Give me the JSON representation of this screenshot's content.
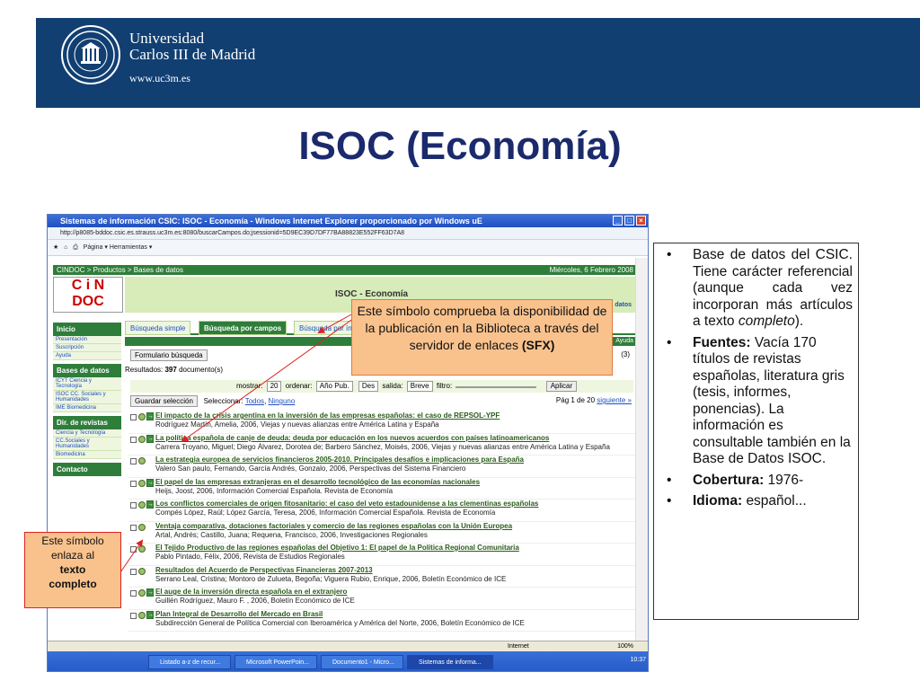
{
  "header": {
    "university_line1": "Universidad",
    "university_line2": "Carlos III de Madrid",
    "url": "www.uc3m.es"
  },
  "slide_title": "ISOC (Economía)",
  "browser": {
    "window_title": "Sistemas de información CSIC: ISOC - Economía - Windows Internet Explorer proporcionado por Windows uE",
    "address": "http://p8085-bddoc.csic.es.strauss.uc3m.es:8080/buscarCampos.do;jsessionid=5D9EC39D7DF77BA88823E552FF63D7A8",
    "toolbar": "Página ▾   Herramientas ▾",
    "cindoc_breadcrumb": "CINDOC  > Productos > Bases de datos",
    "date": "Miércoles, 6 Febrero 2008",
    "logo_text_1": "C i N",
    "logo_text_2": "DOC",
    "isoc_title": "ISOC - Economía",
    "datos_link": "datos",
    "sidebar": [
      {
        "head": "Inicio",
        "items": [
          "Presentación",
          "Suscripción",
          "Ayuda"
        ]
      },
      {
        "head": "Bases de datos",
        "items": [
          "ICYT Ciencia y Tecnología",
          "ISOC CC. Sociales y Humanidades",
          "IME Biomedicina"
        ]
      },
      {
        "head": "Dir. de revistas",
        "items": [
          "Ciencia y Tecnología",
          "CC.Sociales y Humanidades",
          "Biomedicina"
        ]
      },
      {
        "head": "Contacto",
        "items": []
      }
    ],
    "tabs": [
      "Búsqueda simple",
      "Búsqueda por campos",
      "Búsqueda por índ"
    ],
    "ayuda": "Ayuda",
    "form_button": "Formulario búsqueda",
    "count_right": "(3)",
    "results_label": "Resultados:",
    "results_count": "397",
    "results_suffix": "documento(s)",
    "controls": {
      "mostrar_label": "mostrar:",
      "mostrar_value": "20",
      "ordenar_label": "ordenar:",
      "ordenar_value": "Año Pub.",
      "dir_value": "Des",
      "salida_label": "salida:",
      "salida_value": "Breve",
      "filtro_label": "filtro:",
      "aplicar": "Aplicar"
    },
    "guardar": "Guardar selección",
    "seleccionar": "Seleccionar:",
    "todos": "Todos",
    "ninguno": "Ninguno",
    "page_info": "Pág 1 de 20",
    "siguiente": "siguiente »",
    "records": [
      {
        "title": "El impacto de la crisis argentina en la inversión de las empresas españolas: el caso de REPSOL-YPF",
        "authors": "Rodríguez Martín, Amelia,  2006,  Viejas y nuevas alianzas entre América Latina y España",
        "sfx": true
      },
      {
        "title": "La política española de canje de deuda: deuda por educación en los nuevos acuerdos con países latinoamericanos",
        "authors": "Carrera Troyano, Miguel; Diego Álvarez, Dorotea de; Barbero Sánchez, Moisés,  2006,  Viejas y nuevas alianzas entre América Latina y España",
        "sfx": true
      },
      {
        "title": "La estrategia europea de servicios financieros 2005-2010. Principales desafíos e implicaciones para España",
        "authors": "Valero San paulo, Fernando, García Andrés, Gonzalo,  2006,  Perspectivas del Sistema Financiero",
        "sfx": false
      },
      {
        "title": "El papel de las empresas extranjeras en el desarrollo tecnológico de las economías nacionales",
        "authors": "Heijs, Joost,  2006,  Información Comercial Española. Revista de Economía",
        "sfx": true
      },
      {
        "title": "Los conflictos comerciales de origen fitosanitario: el caso del veto estadounidense a las clementinas españolas",
        "authors": "Compés López, Raúl; López García, Teresa,  2006,  Información Comercial Española. Revista de Economía",
        "sfx": true
      },
      {
        "title": "Ventaja comparativa, dotaciones factoriales y comercio de las regiones españolas con la Unión Europea",
        "authors": "Artal, Andrés; Castillo, Juana; Requena, Francisco,  2006,  Investigaciones Regionales",
        "sfx": false
      },
      {
        "title": "El Tejido Productivo de las regiones españolas del Objetivo 1: El papel de la Política Regional Comunitaria",
        "authors": "Pablo Pintado, Félix,  2006,  Revista de Estudios Regionales",
        "sfx": false
      },
      {
        "title": "Resultados del Acuerdo de Perspectivas Financieras 2007-2013",
        "authors": "Serrano Leal, Cristina; Montoro de Zulueta, Begoña; Viguera Rubio, Enrique,  2006,  Boletín Económico de ICE",
        "sfx": false
      },
      {
        "title": "El auge de la inversión directa española en el extranjero",
        "authors": "Guillén Rodríguez, Mauro F. ,  2006,  Boletín Económico de ICE",
        "sfx": true
      },
      {
        "title": "Plan Integral de Desarrollo del Mercado en Brasil",
        "authors": "Subdirección General de Política Comercial con Iberoamérica y América del Norte,  2006,  Boletín Económico de ICE",
        "sfx": true
      }
    ],
    "status_internet": "Internet",
    "status_zoom": "100%",
    "taskbar": [
      "Listado a-z de recur...",
      "Microsoft PowerPoin...",
      "Documento1 - Micro...",
      "Sistemas de informa..."
    ],
    "clock": "10:37"
  },
  "callout_sfx": {
    "line1": "Este símbolo comprueba la disponibilidad de la publicación en la Biblioteca a través del servidor de enlaces",
    "bold": "(SFX)"
  },
  "callout_left": {
    "line1": "Este símbolo enlaza al",
    "bold1": "texto",
    "bold2": "completo"
  },
  "notes": {
    "item1_text": "Base de datos del CSIC. Tiene carácter referencial (aunque cada vez incorporan más artículos a texto",
    "item1_italic": "completo",
    "item1_end": ").",
    "item2_label": "Fuentes:",
    "item2_text": "Vacía 170 títulos de revistas españolas, literatura gris (tesis, informes, ponencias). La información es consultable también en la Base de Datos ISOC.",
    "item3_label": "Cobertura:",
    "item3_text": "1976-",
    "item4_label": "Idioma:",
    "item4_text": "español..."
  }
}
